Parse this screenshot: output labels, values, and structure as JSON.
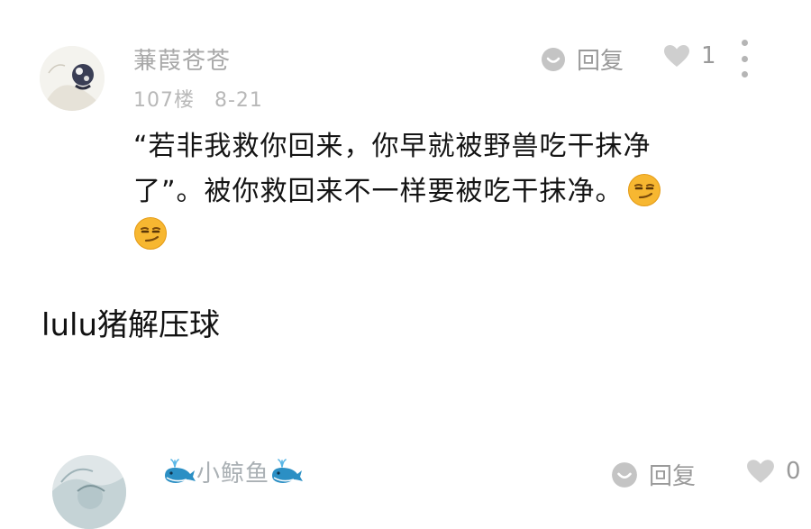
{
  "comment_1": {
    "username": "蒹葭苍苍",
    "floor": "107楼",
    "date": "8-21",
    "reply_label": "回复",
    "like_count": "1",
    "text_line_1": "“若非我救你回来，你早就被野兽吃干抹净",
    "text_line_2": "了”。被你救回来不一样要被吃干抹净。",
    "emoji": "smirk-emoji"
  },
  "caption": "lulu猪解压球",
  "comment_2": {
    "username": "小鲸鱼",
    "username_decoration": "whale-emoji",
    "reply_label": "回复",
    "like_count": "0"
  },
  "colors": {
    "username": "#a8a8a8",
    "meta": "#b8b8b8",
    "icon_gray": "#c4c4c4",
    "emoji_yellow": "#f7b731"
  }
}
